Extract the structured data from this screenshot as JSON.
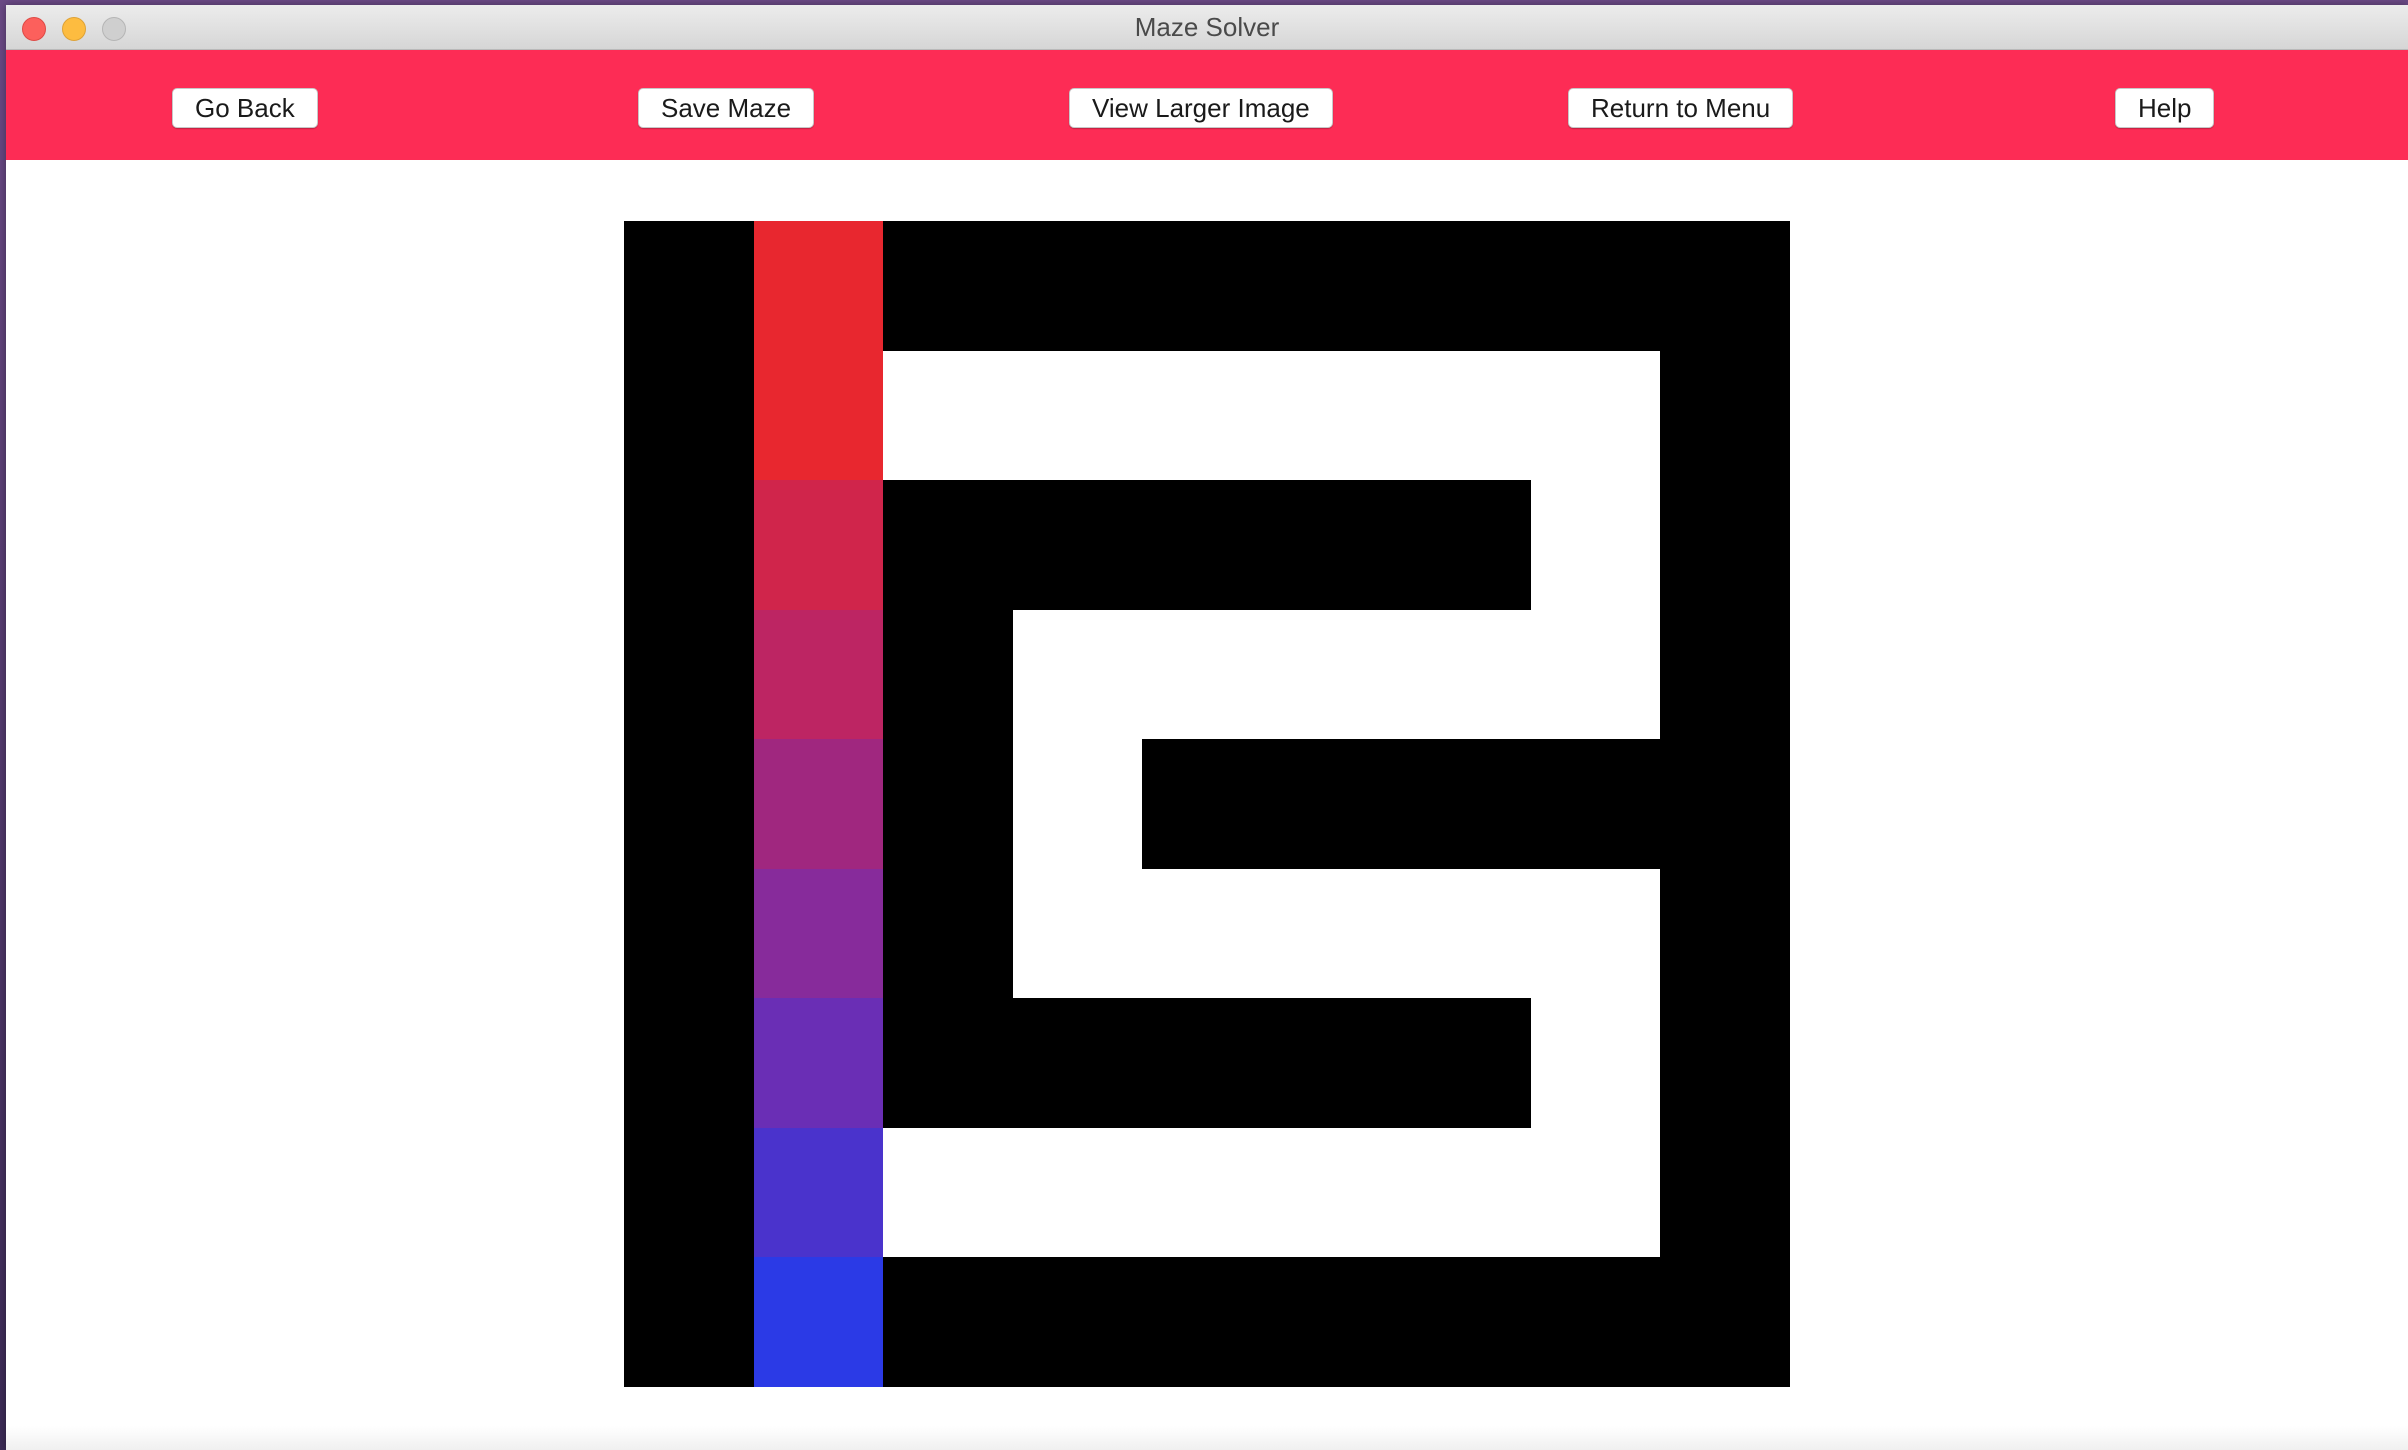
{
  "window": {
    "title": "Maze Solver"
  },
  "toolbar": {
    "background": "#fd2c55",
    "buttons": [
      {
        "name": "go-back-button",
        "label": "Go Back"
      },
      {
        "name": "save-maze-button",
        "label": "Save Maze"
      },
      {
        "name": "view-larger-image-button",
        "label": "View Larger Image"
      },
      {
        "name": "return-to-menu-button",
        "label": "Return to Menu"
      },
      {
        "name": "help-button",
        "label": "Help"
      }
    ]
  },
  "maze": {
    "rows": 9,
    "cols": 9,
    "legend": {
      "#": "wall",
      ".": "open",
      "P": "solution path"
    },
    "grid": [
      "#P#######",
      "#P......#",
      "#P#####.#",
      "#P#.....#",
      "#P#.#####",
      "#P#.....#",
      "#P#####.#",
      "#P......#",
      "#P#######"
    ],
    "colors": {
      "wall": "#000000",
      "open": "#ffffff"
    },
    "path_colors": [
      "#e8272f",
      "#e8272f",
      "#d0254b",
      "#bd2563",
      "#a0277f",
      "#872b9b",
      "#6a2eb5",
      "#4a33cc",
      "#2b3ae6"
    ]
  }
}
